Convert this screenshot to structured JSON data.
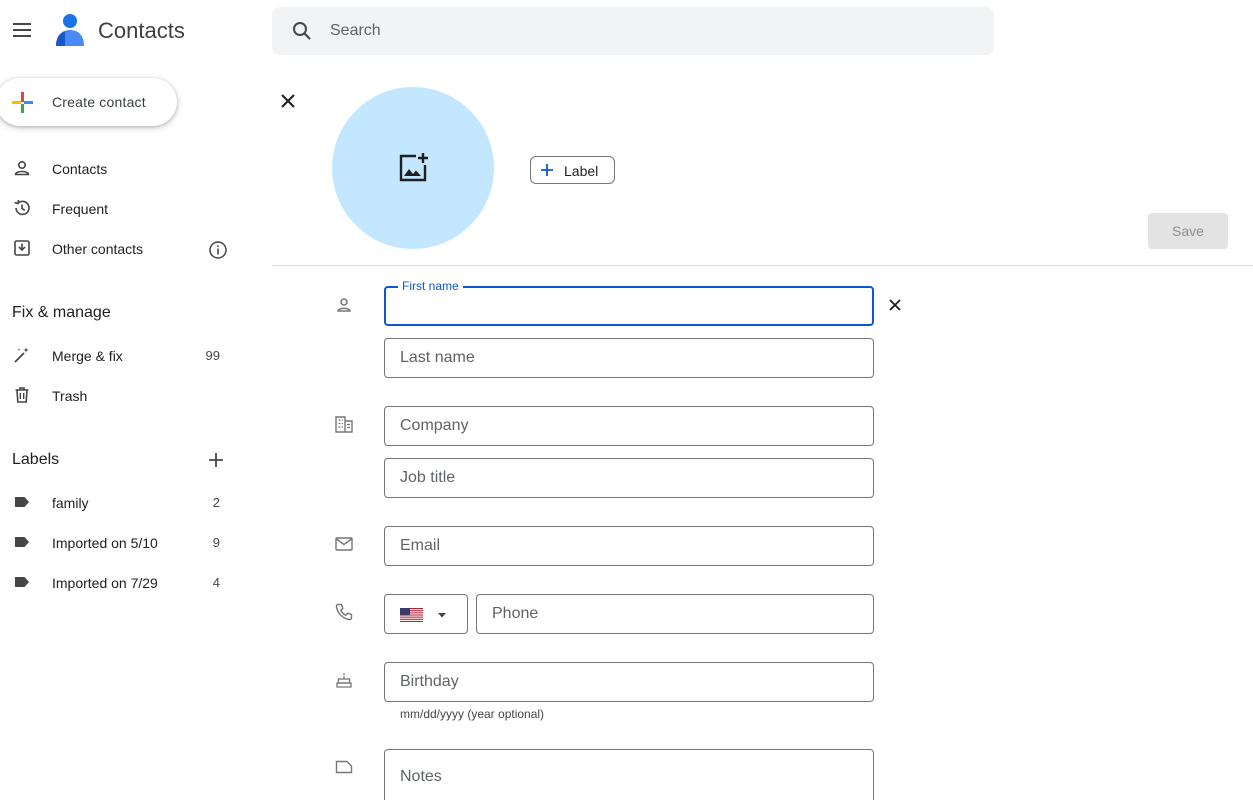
{
  "header": {
    "app_title": "Contacts",
    "search_placeholder": "Search",
    "icons": {
      "menu": "hamburger-menu-icon",
      "logo": "contacts-person-logo",
      "search": "search-icon"
    }
  },
  "sidebar": {
    "create_label": "Create contact",
    "nav": [
      {
        "label": "Contacts",
        "icon": "person-outline-icon"
      },
      {
        "label": "Frequent",
        "icon": "history-icon"
      },
      {
        "label": "Other contacts",
        "icon": "archive-download-icon",
        "info_icon": "info-icon"
      }
    ],
    "fix_title": "Fix & manage",
    "fix_items": [
      {
        "label": "Merge & fix",
        "count": "99",
        "icon": "magic-wand-icon"
      },
      {
        "label": "Trash",
        "icon": "trash-icon"
      }
    ],
    "labels_title": "Labels",
    "labels": [
      {
        "label": "family",
        "count": "2",
        "icon": "label-tag-icon"
      },
      {
        "label": "Imported on 5/10",
        "count": "9",
        "icon": "label-tag-icon"
      },
      {
        "label": "Imported on 7/29",
        "count": "4",
        "icon": "label-tag-icon"
      }
    ]
  },
  "editor": {
    "label_button": "Label",
    "save_label": "Save",
    "fields": {
      "first_name": {
        "label": "First name",
        "value": ""
      },
      "last_name": {
        "placeholder": "Last name",
        "value": ""
      },
      "company": {
        "placeholder": "Company",
        "value": ""
      },
      "job_title": {
        "placeholder": "Job title",
        "value": ""
      },
      "email": {
        "placeholder": "Email",
        "value": ""
      },
      "phone": {
        "placeholder": "Phone",
        "value": ""
      },
      "birthday": {
        "placeholder": "Birthday",
        "value": "",
        "hint": "mm/dd/yyyy (year optional)"
      },
      "notes": {
        "placeholder": "Notes",
        "value": ""
      }
    },
    "country": {
      "flag": "us-flag"
    }
  },
  "colors": {
    "accent": "#0b57d0",
    "avatar_bg": "#c2e7ff",
    "logo_blue": "#1a73e8",
    "save_disabled_bg": "#e3e3e3",
    "search_bg": "#f1f3f4"
  }
}
